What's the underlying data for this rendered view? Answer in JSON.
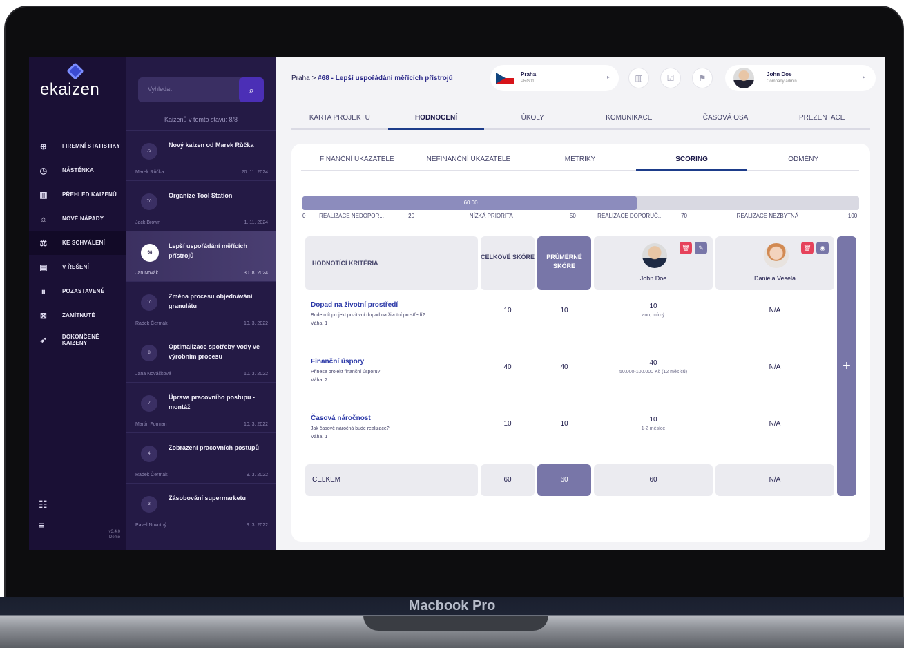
{
  "device_label": "Macbook Pro",
  "brand": "ekaizen",
  "nav": [
    {
      "icon": "globe-icon",
      "label": "FIREMNÍ STATISTIKY"
    },
    {
      "icon": "clock-icon",
      "label": "NÁSTĚNKA"
    },
    {
      "icon": "kanban-icon",
      "label": "PŘEHLED KAIZENŮ"
    },
    {
      "icon": "bulb-icon",
      "label": "NOVÉ NÁPADY"
    },
    {
      "icon": "scale-icon",
      "label": "KE SCHVÁLENÍ"
    },
    {
      "icon": "clipboard-icon",
      "label": "V ŘEŠENÍ"
    },
    {
      "icon": "paused-icon",
      "label": "POZASTAVENÉ"
    },
    {
      "icon": "rejected-icon",
      "label": "ZAMÍTNUTÉ"
    },
    {
      "icon": "rocket-icon",
      "label": "DOKONČENÉ KAIZENY"
    }
  ],
  "version": "v3.4.0",
  "env": "Demo",
  "search": {
    "placeholder": "Vyhledat"
  },
  "kaizen_count": "Kaizenů v tomto stavu: 8/8",
  "kaizens": [
    {
      "id": "73",
      "title": "Nový kaizen od Marek Růčka",
      "author": "Marek Růčka",
      "date": "20. 11. 2024"
    },
    {
      "id": "70",
      "title": "Organize Tool Station",
      "author": "Jack Brown",
      "date": "1. 11. 2024"
    },
    {
      "id": "68",
      "title": "Lepší uspořádání měřících přístrojů",
      "author": "Jan Novák",
      "date": "30. 8. 2024"
    },
    {
      "id": "10",
      "title": "Změna procesu objednávání granulátu",
      "author": "Radek Čermák",
      "date": "10. 3. 2022"
    },
    {
      "id": "8",
      "title": "Optimalizace spotřeby vody ve výrobním procesu",
      "author": "Jana Nováčková",
      "date": "10. 3. 2022"
    },
    {
      "id": "7",
      "title": "Úprava pracovního postupu - montáž",
      "author": "Martin Forman",
      "date": "10. 3. 2022"
    },
    {
      "id": "4",
      "title": "Zobrazení pracovních postupů",
      "author": "Radek Čermák",
      "date": "9. 3. 2022"
    },
    {
      "id": "3",
      "title": "Zásobování supermarketu",
      "author": "Pavel Novotný",
      "date": "9. 3. 2022"
    }
  ],
  "breadcrumb": {
    "root": "Praha",
    "current": "#68 - Lepší uspořádání měřících přístrojů"
  },
  "location": {
    "city": "Praha",
    "code": "PRG01"
  },
  "user": {
    "name": "John Doe",
    "role": "Company admin"
  },
  "tabs": [
    "KARTA PROJEKTU",
    "HODNOCENÍ",
    "ÚKOLY",
    "KOMUNIKACE",
    "ČASOVÁ OSA",
    "PREZENTACE"
  ],
  "subtabs": [
    "FINANČNÍ UKAZATELE",
    "NEFINANČNÍ UKAZATELE",
    "METRIKY",
    "SCORING",
    "ODMĚNY"
  ],
  "score": {
    "value": "60.00",
    "fraction": 0.6
  },
  "scale": [
    {
      "t": "0"
    },
    {
      "t": "REALIZACE NEDOPOR..."
    },
    {
      "t": "20"
    },
    {
      "t": "NÍZKÁ PRIORITA"
    },
    {
      "t": "50"
    },
    {
      "t": "REALIZACE DOPORUČ..."
    },
    {
      "t": "70"
    },
    {
      "t": "REALIZACE NEZBYTNÁ"
    },
    {
      "t": "100"
    }
  ],
  "headers": {
    "criteria": "HODNOTÍCÍ KRITÉRIA",
    "total": "CELKOVÉ SKÓRE",
    "avg": "PRŮMĚRNÉ SKÓRE"
  },
  "evaluators": [
    {
      "name": "John Doe"
    },
    {
      "name": "Daniela Veselá"
    }
  ],
  "rows": [
    {
      "title": "Dopad na životní prostředí",
      "desc": "Bude mít projekt pozitivní dopad na životní prostředí?",
      "weight": "Váha: 1",
      "total": "10",
      "avg": "10",
      "jd": "10",
      "jd_note": "ano, mírný",
      "dv": "N/A"
    },
    {
      "title": "Finanční úspory",
      "desc": "Přinese projekt finanční úsporu?",
      "weight": "Váha: 2",
      "total": "40",
      "avg": "40",
      "jd": "40",
      "jd_note": "50.000-100.000 Kč (12 měsíců)",
      "dv": "N/A"
    },
    {
      "title": "Časová náročnost",
      "desc": "Jak časově náročná bude realizace?",
      "weight": "Váha: 1",
      "total": "10",
      "avg": "10",
      "jd": "10",
      "jd_note": "1-2 měsíce",
      "dv": "N/A"
    }
  ],
  "totals": {
    "label": "CELKEM",
    "total": "60",
    "avg": "60",
    "jd": "60",
    "dv": "N/A"
  },
  "colors": {
    "nav": "#1a1035",
    "accent": "#7876a8",
    "link": "#2d3aa8",
    "danger": "#e6425b"
  }
}
